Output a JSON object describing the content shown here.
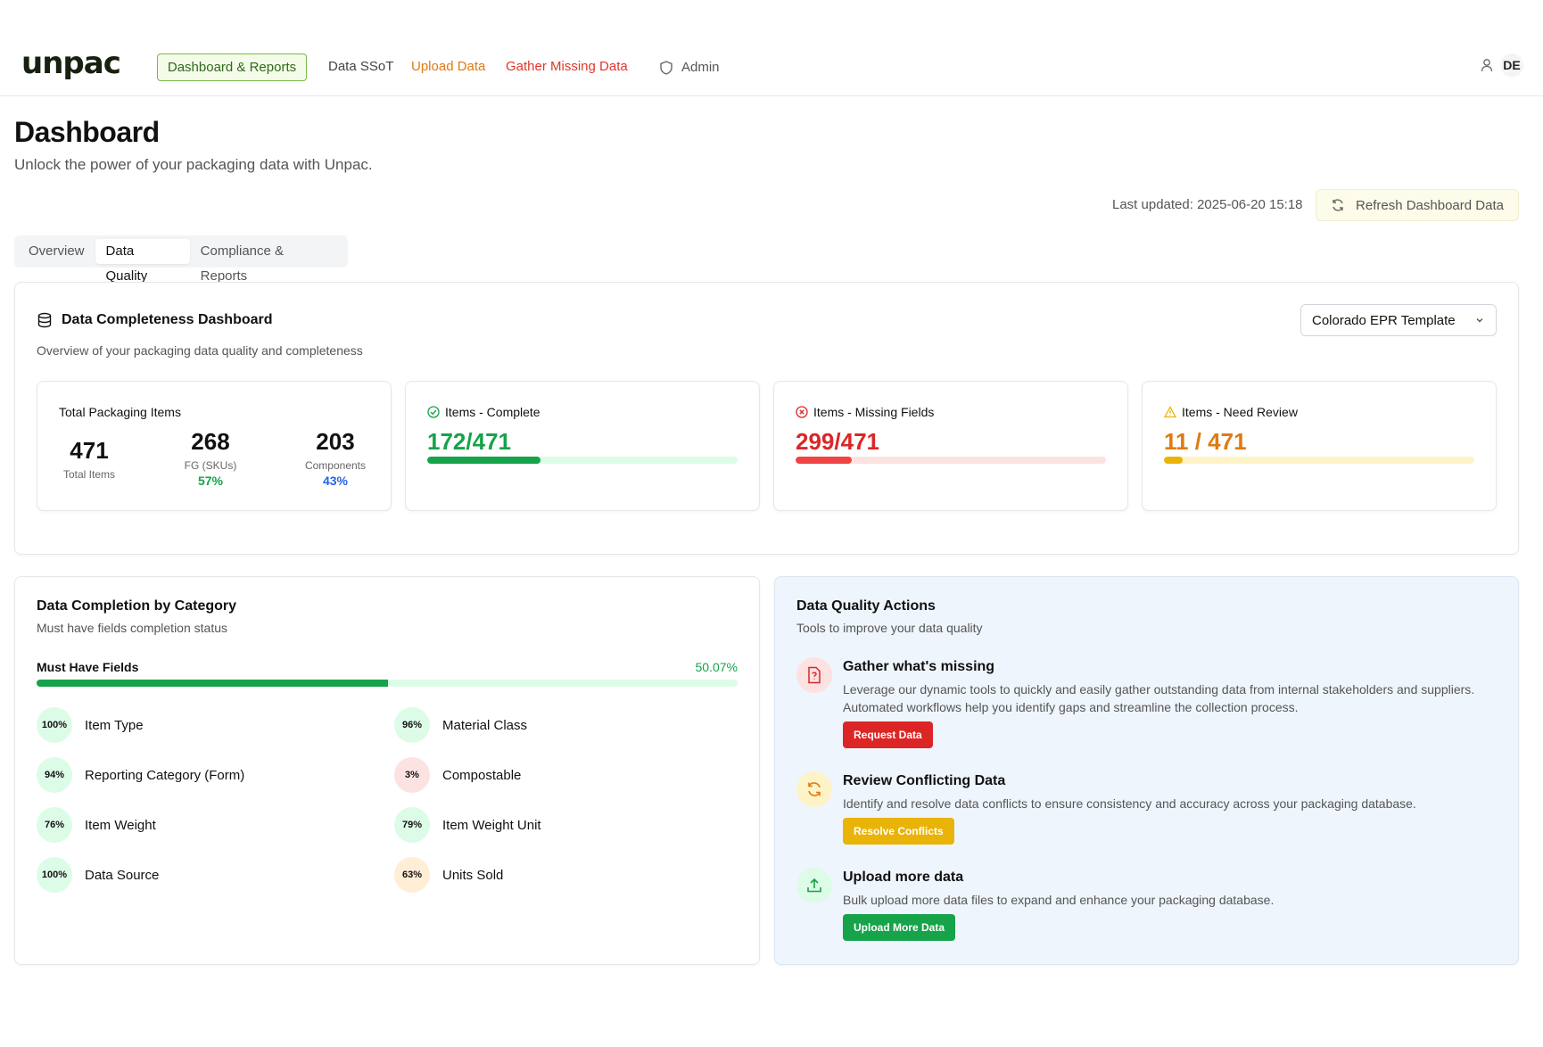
{
  "nav": {
    "logo": "unpac",
    "dashboard": "Dashboard & Reports",
    "ssot": "Data SSoT",
    "upload": "Upload Data",
    "gather": "Gather Missing Data",
    "admin": "Admin",
    "user_initials": "DE"
  },
  "header": {
    "title": "Dashboard",
    "subtitle": "Unlock the power of your packaging data with Unpac.",
    "last_updated": "Last updated: 2025-06-20 15:18",
    "refresh": "Refresh Dashboard Data"
  },
  "tabs": [
    "Overview",
    "Data Quality",
    "Compliance & Reports"
  ],
  "completeness": {
    "title": "Data Completeness Dashboard",
    "subtitle": "Overview of your packaging data quality and completeness",
    "template": "Colorado EPR Template",
    "total": {
      "label": "Total Packaging Items",
      "total_num": "471",
      "total_lbl": "Total Items",
      "fg_num": "268",
      "fg_lbl": "FG (SKUs)",
      "fg_pct": "57%",
      "comp_num": "203",
      "comp_lbl": "Components",
      "comp_pct": "43%"
    },
    "complete": {
      "label": "Items - Complete",
      "value": "172/471",
      "fraction": 0.365
    },
    "missing": {
      "label": "Items - Missing Fields",
      "value": "299/471",
      "fraction": 0.18
    },
    "review": {
      "label": "Items - Need Review",
      "value": "11 / 471",
      "fraction": 0.06
    }
  },
  "category": {
    "title": "Data Completion by Category",
    "subtitle": "Must have fields completion status",
    "must_have_label": "Must Have Fields",
    "must_have_pct": "50.07%",
    "must_have_fraction": 0.5007,
    "fields": [
      {
        "pct": "100%",
        "name": "Item Type",
        "bg": "#dcfce7"
      },
      {
        "pct": "96%",
        "name": "Material Class",
        "bg": "#dcfce7"
      },
      {
        "pct": "94%",
        "name": "Reporting Category (Form)",
        "bg": "#dcfce7"
      },
      {
        "pct": "3%",
        "name": "Compostable",
        "bg": "#fde2e2"
      },
      {
        "pct": "76%",
        "name": "Item Weight",
        "bg": "#dcfce7"
      },
      {
        "pct": "79%",
        "name": "Item Weight Unit",
        "bg": "#dcfce7"
      },
      {
        "pct": "100%",
        "name": "Data Source",
        "bg": "#dcfce7"
      },
      {
        "pct": "63%",
        "name": "Units Sold",
        "bg": "#ffedd5"
      }
    ]
  },
  "actions": {
    "title": "Data Quality Actions",
    "subtitle": "Tools to improve your data quality",
    "items": [
      {
        "title": "Gather what's missing",
        "desc": "Leverage our dynamic tools to quickly and easily gather outstanding data from internal stakeholders and suppliers. Automated workflows help you identify gaps and streamline the collection process.",
        "button": "Request Data"
      },
      {
        "title": "Review Conflicting Data",
        "desc": "Identify and resolve data conflicts to ensure consistency and accuracy across your packaging database.",
        "button": "Resolve Conflicts"
      },
      {
        "title": "Upload more data",
        "desc": "Bulk upload more data files to expand and enhance your packaging database.",
        "button": "Upload More Data"
      }
    ]
  },
  "colors": {
    "green": "#16a34a",
    "red": "#dc2626",
    "amber": "#eab308",
    "orange": "#e07a10",
    "blue": "#2563eb"
  }
}
